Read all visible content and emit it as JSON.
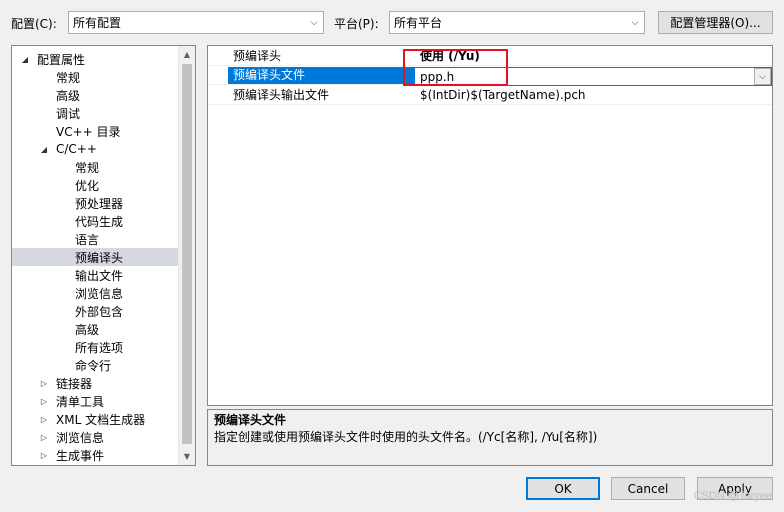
{
  "config": {
    "label": "配置(C):",
    "value": "所有配置",
    "platform_label": "平台(P):",
    "platform_value": "所有平台",
    "manager_button": "配置管理器(O)..."
  },
  "tree": {
    "items": [
      {
        "label": "配置属性",
        "indent": 0,
        "toggle": "◢"
      },
      {
        "label": "常规",
        "indent": 1,
        "toggle": ""
      },
      {
        "label": "高级",
        "indent": 1,
        "toggle": ""
      },
      {
        "label": "调试",
        "indent": 1,
        "toggle": ""
      },
      {
        "label": "VC++ 目录",
        "indent": 1,
        "toggle": ""
      },
      {
        "label": "C/C++",
        "indent": 1,
        "toggle": "◢"
      },
      {
        "label": "常规",
        "indent": 2,
        "toggle": ""
      },
      {
        "label": "优化",
        "indent": 2,
        "toggle": ""
      },
      {
        "label": "预处理器",
        "indent": 2,
        "toggle": ""
      },
      {
        "label": "代码生成",
        "indent": 2,
        "toggle": ""
      },
      {
        "label": "语言",
        "indent": 2,
        "toggle": ""
      },
      {
        "label": "预编译头",
        "indent": 2,
        "toggle": "",
        "selected": true
      },
      {
        "label": "输出文件",
        "indent": 2,
        "toggle": ""
      },
      {
        "label": "浏览信息",
        "indent": 2,
        "toggle": ""
      },
      {
        "label": "外部包含",
        "indent": 2,
        "toggle": ""
      },
      {
        "label": "高级",
        "indent": 2,
        "toggle": ""
      },
      {
        "label": "所有选项",
        "indent": 2,
        "toggle": ""
      },
      {
        "label": "命令行",
        "indent": 2,
        "toggle": ""
      },
      {
        "label": "链接器",
        "indent": 1,
        "toggle": "▷"
      },
      {
        "label": "清单工具",
        "indent": 1,
        "toggle": "▷"
      },
      {
        "label": "XML 文档生成器",
        "indent": 1,
        "toggle": "▷"
      },
      {
        "label": "浏览信息",
        "indent": 1,
        "toggle": "▷"
      },
      {
        "label": "生成事件",
        "indent": 1,
        "toggle": "▷"
      }
    ]
  },
  "properties": [
    {
      "name": "预编译头",
      "value": "使用 (/Yu)",
      "bold": true
    },
    {
      "name": "预编译头文件",
      "value": "ppp.h",
      "editing": true
    },
    {
      "name": "预编译头输出文件",
      "value": "$(IntDir)$(TargetName).pch"
    }
  ],
  "description": {
    "title": "预编译头文件",
    "text": "指定创建或使用预编译头文件时使用的头文件名。(/Yc[名称], /Yu[名称])"
  },
  "buttons": {
    "ok": "OK",
    "cancel": "Cancel",
    "apply": "Apply"
  },
  "watermark": "CSDN @Taryee",
  "colors": {
    "selection": "#0078d7",
    "tree_selection": "#d5d7e1",
    "highlight_box": "#e81123"
  }
}
